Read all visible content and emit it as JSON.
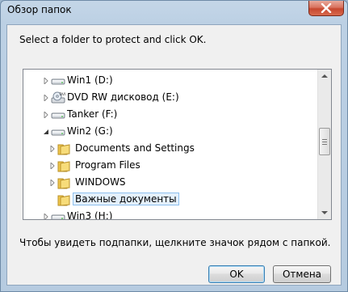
{
  "window": {
    "title": "Обзор папок"
  },
  "dialog": {
    "instruction": "Select a folder to protect and click OK.",
    "hint": "Чтобы увидеть подпапки, щелкните значок рядом с папкой."
  },
  "tree": {
    "items": [
      {
        "label": "Win1 (D:)",
        "icon": "drive-icon",
        "expander": "collapsed"
      },
      {
        "label": "DVD RW дисковод (E:)",
        "icon": "dvd-drive-icon",
        "expander": "collapsed"
      },
      {
        "label": "Tanker (F:)",
        "icon": "drive-icon",
        "expander": "collapsed"
      },
      {
        "label": "Win2 (G:)",
        "icon": "drive-icon",
        "expander": "expanded"
      },
      {
        "label": "Documents and Settings",
        "icon": "folder-icon",
        "expander": "collapsed"
      },
      {
        "label": "Program Files",
        "icon": "folder-icon",
        "expander": "collapsed"
      },
      {
        "label": "WINDOWS",
        "icon": "folder-icon",
        "expander": "collapsed"
      },
      {
        "label": "Важные документы",
        "icon": "folder-icon",
        "expander": "none",
        "selected": true
      },
      {
        "label": "Win3 (H:)",
        "icon": "drive-icon",
        "expander": "collapsed"
      }
    ]
  },
  "buttons": {
    "ok": "OK",
    "cancel": "Отмена"
  },
  "colors": {
    "selection_bg": "#e3f0fc",
    "selection_border": "#8ec0ee",
    "folder": "#f2c94c"
  }
}
